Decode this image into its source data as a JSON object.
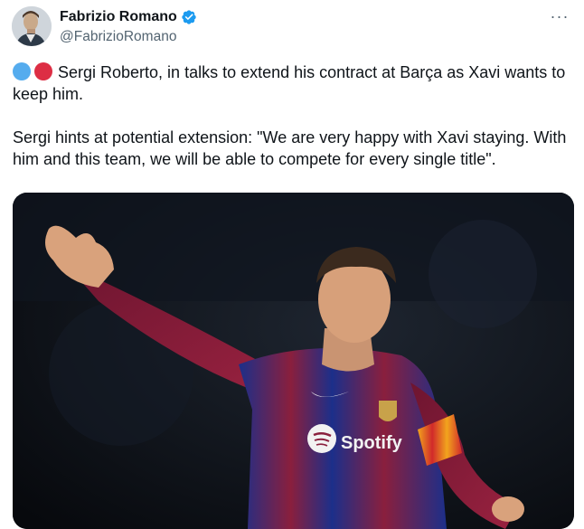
{
  "author": {
    "display_name": "Fabrizio Romano",
    "handle": "@FabrizioRomano",
    "avatar_icon": "profile-photo",
    "verified_icon": "verified-badge-icon"
  },
  "tweet": {
    "line1": "Sergi Roberto, in talks to extend his contract at Barça as Xavi wants to keep him.",
    "line2": "Sergi hints at potential extension: \"We are very happy with Xavi staying. With him and this team, we will be able to compete for every single title\".",
    "emoji": [
      "blue-circle",
      "red-circle"
    ]
  },
  "media": {
    "sponsor_text": "Spotify",
    "description_icon": "football-player-photo"
  },
  "menu": {
    "more_label": "···"
  },
  "colors": {
    "text": "#0f1419",
    "secondary": "#536471",
    "verified": "#1d9bf0",
    "blue_circle": "#55acee",
    "red_circle": "#dd2e44"
  }
}
